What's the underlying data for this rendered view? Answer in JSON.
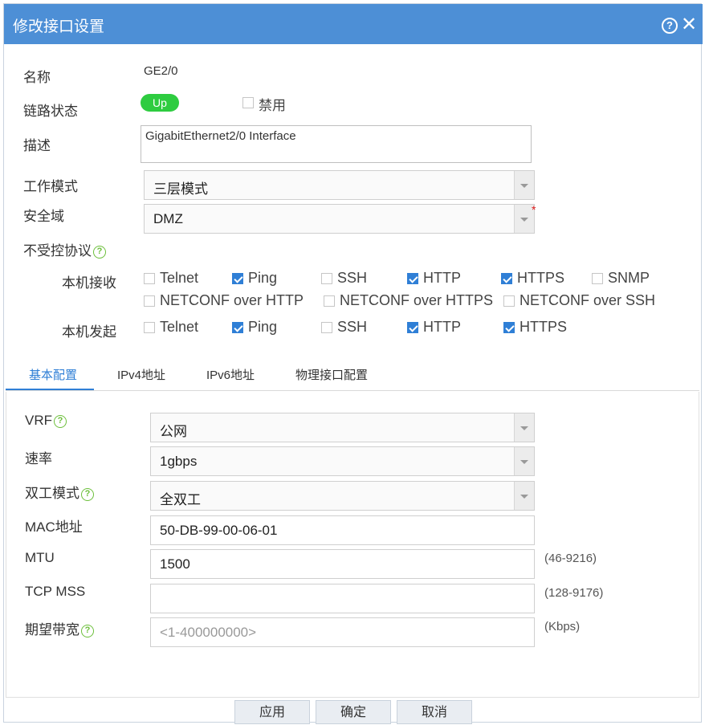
{
  "dialog": {
    "title": "修改接口设置",
    "help_glyph": "?",
    "close_glyph": "✕"
  },
  "form": {
    "name_label": "名称",
    "name_value": "GE2/0",
    "link_label": "链路状态",
    "link_status": "Up",
    "disable_label": "禁用",
    "desc_label": "描述",
    "desc_value": "GigabitEthernet2/0 Interface",
    "mode_label": "工作模式",
    "mode_value": "三层模式",
    "zone_label": "安全域",
    "zone_value": "DMZ",
    "required_mark": "*",
    "protocol_label": "不受控协议",
    "recv_label": "本机接收",
    "send_label": "本机发起",
    "recv_row1": [
      {
        "label": "Telnet",
        "checked": false
      },
      {
        "label": "Ping",
        "checked": true
      },
      {
        "label": "SSH",
        "checked": false
      },
      {
        "label": "HTTP",
        "checked": true
      },
      {
        "label": "HTTPS",
        "checked": true
      },
      {
        "label": "SNMP",
        "checked": false
      }
    ],
    "recv_row2": [
      {
        "label": "NETCONF over HTTP",
        "checked": false
      },
      {
        "label": "NETCONF over HTTPS",
        "checked": false
      },
      {
        "label": "NETCONF over SSH",
        "checked": false
      }
    ],
    "send_row": [
      {
        "label": "Telnet",
        "checked": false
      },
      {
        "label": "Ping",
        "checked": true
      },
      {
        "label": "SSH",
        "checked": false
      },
      {
        "label": "HTTP",
        "checked": true
      },
      {
        "label": "HTTPS",
        "checked": true
      }
    ]
  },
  "tabs": [
    {
      "label": "基本配置",
      "active": true
    },
    {
      "label": "IPv4地址",
      "active": false
    },
    {
      "label": "IPv6地址",
      "active": false
    },
    {
      "label": "物理接口配置",
      "active": false
    }
  ],
  "basic": {
    "vrf_label": "VRF",
    "vrf_value": "公网",
    "speed_label": "速率",
    "speed_value": "1gbps",
    "duplex_label": "双工模式",
    "duplex_value": "全双工",
    "mac_label": "MAC地址",
    "mac_value": "50-DB-99-00-06-01",
    "mtu_label": "MTU",
    "mtu_value": "1500",
    "mtu_hint": "(46-9216)",
    "mss_label": "TCP MSS",
    "mss_value": "",
    "mss_hint": "(128-9176)",
    "bw_label": "期望带宽",
    "bw_placeholder": "<1-400000000>",
    "bw_hint": "(Kbps)"
  },
  "buttons": {
    "apply": "应用",
    "ok": "确定",
    "cancel": "取消"
  },
  "colors": {
    "titlebar": "#4d8fd6",
    "accent": "#2f7fd6",
    "status_up": "#2ecc40",
    "help_icon": "#6cbf3b"
  }
}
